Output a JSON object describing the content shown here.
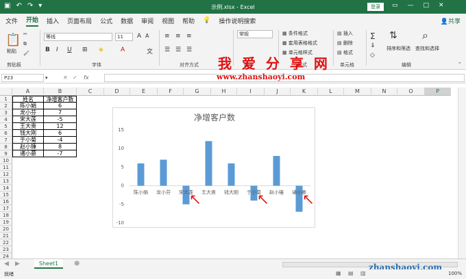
{
  "titlebar": {
    "title": "示例.xlsx - Excel",
    "login": "登录"
  },
  "tabs": [
    "文件",
    "开始",
    "插入",
    "页面布局",
    "公式",
    "数据",
    "审阅",
    "视图",
    "帮助"
  ],
  "tell_me": "操作说明搜索",
  "share": "共享",
  "ribbon": {
    "paste": "粘贴",
    "clipboard_label": "剪贴板",
    "font_name": "等线",
    "font_size": "11",
    "font_label": "字体",
    "align_label": "对齐方式",
    "number_format": "常规",
    "number_label": "数字",
    "cond_format": "条件格式",
    "table_format": "套用表格格式",
    "cell_style": "单元格样式",
    "styles_label": "样式",
    "insert": "插入",
    "delete": "删除",
    "format": "格式",
    "cells_label": "单元格",
    "sort_filter": "排序和筛选",
    "find_select": "查找和选择",
    "edit_label": "编辑"
  },
  "formula_bar": {
    "name_box": "P23",
    "fx": "fx"
  },
  "columns": [
    "A",
    "B",
    "C",
    "D",
    "E",
    "F",
    "G",
    "H",
    "I",
    "J",
    "K",
    "L",
    "M",
    "N",
    "O",
    "P"
  ],
  "rows": [
    "1",
    "2",
    "3",
    "4",
    "5",
    "6",
    "7",
    "8",
    "9",
    "10",
    "11",
    "12",
    "13",
    "14",
    "15",
    "16",
    "17",
    "18",
    "19",
    "20",
    "21",
    "22",
    "23",
    "24"
  ],
  "table": {
    "headers": [
      "姓名",
      "净增客户数"
    ],
    "rows": [
      [
        "陈小娟",
        "6"
      ],
      [
        "龙小芬",
        "7"
      ],
      [
        "宋大莲",
        "-5"
      ],
      [
        "王大贵",
        "12"
      ],
      [
        "钱大刚",
        "6"
      ],
      [
        "于小菊",
        "-4"
      ],
      [
        "赵小锤",
        "8"
      ],
      [
        "诸小慕",
        "-7"
      ]
    ]
  },
  "chart_data": {
    "type": "bar",
    "title": "净增客户数",
    "categories": [
      "陈小娟",
      "龙小芬",
      "宋大莲",
      "王大贵",
      "钱大刚",
      "于小菊",
      "赵小锤",
      "诸小慕"
    ],
    "values": [
      6,
      7,
      -5,
      12,
      6,
      -4,
      8,
      -7
    ],
    "ylim": [
      -10,
      15
    ],
    "yticks": [
      "15",
      "10",
      "5",
      "0",
      "-5",
      "-10"
    ],
    "grid": false,
    "bar_color": "#5B9BD5"
  },
  "sheet": {
    "tab": "Sheet1"
  },
  "status": {
    "ready": "就绪",
    "zoom": "100%"
  },
  "watermark": {
    "brand": "我 爱 分 享 网",
    "url": "www.zhanshaoyi.com",
    "url2": "zhanshaoyi.com"
  },
  "colors": {
    "excel_green": "#217346",
    "arrow_red": "#e01010"
  }
}
